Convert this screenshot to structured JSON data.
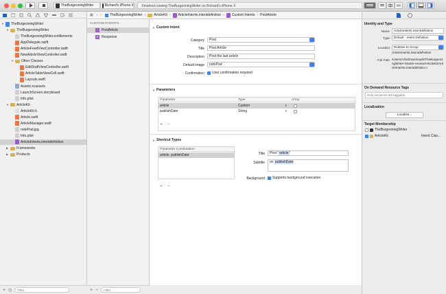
{
  "toolbar": {
    "scheme_target": "TheBurgeoningWriter",
    "scheme_device": "Richard's iPhone X",
    "status": "Finished running TheBurgeoningWriter on Richard's iPhone X"
  },
  "jump": [
    "TheBurgeoningWriter",
    "ArticleKit",
    "ArticleIntents.intentdefinition",
    "Custom Intents",
    "PostArticle"
  ],
  "navigator": [
    {
      "label": "TheBurgeoningWriter",
      "indent": 0,
      "icon": "project-icon",
      "tri": "open"
    },
    {
      "label": "TheBurgeoningWriter",
      "indent": 1,
      "icon": "folder-icon",
      "tri": "open"
    },
    {
      "label": "TheBurgeoningWriter.entitlements",
      "indent": 2,
      "icon": "file-icon"
    },
    {
      "label": "AppDelegate.swift",
      "indent": 2,
      "icon": "swift-icon"
    },
    {
      "label": "ArticleFeedViewController.swift",
      "indent": 2,
      "icon": "swift-icon"
    },
    {
      "label": "NewArticleViewController.swift",
      "indent": 2,
      "icon": "swift-icon"
    },
    {
      "label": "Other Classes",
      "indent": 2,
      "icon": "folder-icon",
      "tri": "open"
    },
    {
      "label": "EditDraftViewController.swift",
      "indent": 3,
      "icon": "swift-icon"
    },
    {
      "label": "ArticleTableViewCell.swift",
      "indent": 3,
      "icon": "swift-icon"
    },
    {
      "label": "Layouts.swift",
      "indent": 3,
      "icon": "swift-icon"
    },
    {
      "label": "Assets.xcassets",
      "indent": 2,
      "icon": "assets-icon"
    },
    {
      "label": "LaunchScreen.storyboard",
      "indent": 2,
      "icon": "file-icon"
    },
    {
      "label": "Info.plist",
      "indent": 2,
      "icon": "file-icon"
    },
    {
      "label": "ArticleKit",
      "indent": 1,
      "icon": "folder-icon",
      "tri": "open"
    },
    {
      "label": "ArticleKit.h",
      "indent": 2,
      "icon": "header-icon"
    },
    {
      "label": "Article.swift",
      "indent": 2,
      "icon": "swift-icon"
    },
    {
      "label": "ArticleManager.swift",
      "indent": 2,
      "icon": "swift-icon"
    },
    {
      "label": "notePad.jpg",
      "indent": 2,
      "icon": "file-icon"
    },
    {
      "label": "Info.plist",
      "indent": 2,
      "icon": "file-icon"
    },
    {
      "label": "ArticleIntents.intentdefinition",
      "indent": 2,
      "icon": "intent-icon",
      "selected": true
    },
    {
      "label": "Frameworks",
      "indent": 1,
      "icon": "folder-icon",
      "tri": "closed"
    },
    {
      "label": "Products",
      "indent": 1,
      "icon": "folder-icon",
      "tri": "closed"
    }
  ],
  "intents": {
    "header": "CUSTOM INTENTS",
    "items": [
      {
        "label": "PostArticle",
        "badge": "I"
      },
      {
        "label": "Response",
        "badge": "R"
      }
    ]
  },
  "custom_intent": {
    "title": "Custom Intent",
    "category_label": "Category",
    "category": "Post",
    "title_label": "Title",
    "title_value": "Post Article",
    "description_label": "Description",
    "description": "Post the last article",
    "image_label": "Default image",
    "image": "notePad",
    "confirmation_label": "Confirmation",
    "confirmation_text": "User confirmation required"
  },
  "parameters": {
    "title": "Parameters",
    "columns": [
      "Parameter",
      "Type",
      "Array"
    ],
    "rows": [
      {
        "name": "article",
        "type": "Custom"
      },
      {
        "name": "publishDate",
        "type": "String"
      }
    ]
  },
  "shortcut": {
    "title": "Shortcut Types",
    "list_header": "Parameter Combination",
    "list_item": "article, publishDate",
    "title_label": "Title",
    "title_prefix": "Post \"",
    "title_token": "article",
    "title_suffix": "\"",
    "subtitle_label": "Subtitle",
    "subtitle_prefix": "on",
    "subtitle_token": "publishDate",
    "background_label": "Background",
    "background_text": "Supports background execution"
  },
  "inspector": {
    "identity_title": "Identity and Type",
    "name_label": "Name",
    "name": "ArticleIntents.intentdefinition",
    "type_label": "Type",
    "type": "Default - Intent Definition",
    "location_label": "Location",
    "location": "Relative to Group",
    "location_file": "ArticleIntents.intentdefinition",
    "fullpath_label": "Full Path",
    "fullpath": "/Users/critz/Downloads/TheBurgeoningWriter-Starter-review/ArticleKit/ArticleIntents.intentdefinitio n",
    "ondemand_title": "On Demand Resource Tags",
    "ondemand_placeholder": "Only resources are taggable",
    "localization_title": "Localization",
    "localize_button": "Localize...",
    "membership_title": "Target Membership",
    "targets": [
      {
        "name": "TheBurgeoningWriter",
        "checked": false,
        "value": ""
      },
      {
        "name": "ArticleKit",
        "checked": true,
        "value": "Intent Clas..."
      }
    ]
  },
  "filter": {
    "placeholder": "Filter"
  },
  "colors": {
    "accent": "#3b82f0",
    "selection": "#1a62c9",
    "folder": "#dcb04a"
  }
}
